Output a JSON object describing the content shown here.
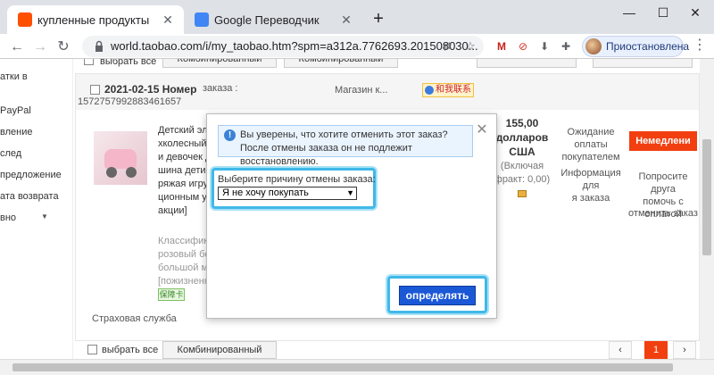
{
  "browser": {
    "tabs": [
      {
        "title": "купленные продукты",
        "active": true
      },
      {
        "title": "Google Переводчик",
        "active": false
      }
    ],
    "url": "world.taobao.com/i/my_taobao.htm?spm=a312a.7762693.201508030...",
    "profile_label": "Приостановлена"
  },
  "sidebar": {
    "items": [
      "атки в",
      "PayPal",
      "вление",
      "след",
      "предложение",
      "ата возврата",
      "вно"
    ]
  },
  "top_row": {
    "select_all": "выбрать все",
    "combined1": "Комбинированный платеж",
    "combined2": "Комбинированный платеж"
  },
  "order": {
    "date": "2021-02-15 Номер",
    "order_label": "заказа :",
    "order_number": "1572757992883461657",
    "shop": "Магазин к...",
    "wangwang": "和我联系",
    "title_lines": [
      "Детский эле",
      "хколесный в",
      "и девочек д",
      "шина дети м",
      "ряжая игруш",
      "ционным упр",
      "акции]"
    ],
    "spec_lines": [
      "Классифика",
      "розовый бол",
      "большой мо",
      "[пожизненн"
    ],
    "badge": "保障卡",
    "insurance": "Страховая служба",
    "price_lines": [
      "155,00",
      "долларов",
      "США"
    ],
    "price_note": [
      "(Включая",
      "фракт: 0,00)"
    ],
    "status_lines": [
      "Ожидание",
      "оплаты",
      "покупателем"
    ],
    "info_lines": [
      "Информация для",
      "я заказа"
    ],
    "pay_button": "Немедлени",
    "friend_lines": [
      "Попросите друга",
      "помочь с оплатой"
    ],
    "cancel_link": "отменить заказ"
  },
  "bottom_bar": {
    "select_all": "выбрать все",
    "combined": "Комбинированный платеж",
    "page": "1"
  },
  "dialog": {
    "notice": "Вы уверены, что хотите отменить этот заказ? После отмены заказа он не подлежит восстановлению.",
    "reason_label": "Выберите причину отмены заказа:",
    "reason_value": "Я не хочу покупать",
    "confirm": "определять"
  },
  "colors": {
    "accent": "#1a58d6",
    "pay": "#f23f10",
    "highlight": "#40b8e8"
  }
}
